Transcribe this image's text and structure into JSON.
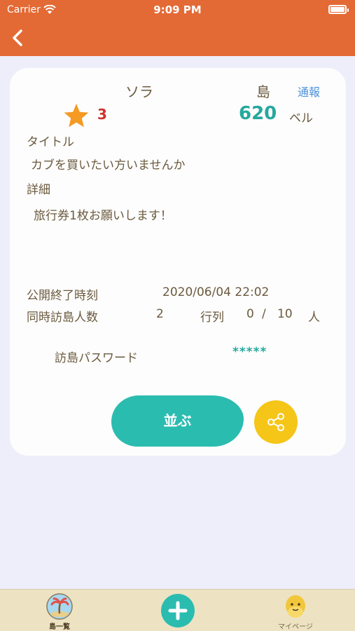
{
  "status_bar": {
    "carrier": "Carrier",
    "time": "9:09 PM"
  },
  "navbar": {
    "back_icon": "chevron-left-icon"
  },
  "card": {
    "owner_name": "ソラ",
    "island_name": "島",
    "report_label": "通報",
    "rating": "3",
    "price": "620",
    "price_unit": "ベル",
    "title_label": "タイトル",
    "title_value": "カブを買いたい方いませんか",
    "detail_label": "詳細",
    "detail_value": "旅行券1枚お願いします！",
    "end_time_label": "公開終了時刻",
    "end_time_value": "2020/06/04 22:02",
    "visitors_label": "同時訪島人数",
    "visitors_value": "2",
    "queue_label": "行列",
    "queue_current": "0",
    "queue_separator": "/",
    "queue_max": "10",
    "queue_unit": "人",
    "password_label": "訪島パスワード",
    "password_value": "*****",
    "queue_button_label": "並ぶ",
    "share_icon": "share-icon"
  },
  "tab_bar": {
    "items": [
      {
        "label": "島一覧",
        "icon": "palm-island-icon",
        "selected": true
      },
      {
        "label": "",
        "icon": "plus-icon"
      },
      {
        "label": "マイページ",
        "icon": "villager-face-icon"
      }
    ]
  },
  "colors": {
    "header": "#e36a35",
    "background": "#eeeefb",
    "accent_teal": "#2bbcb0",
    "accent_yellow": "#f5c518",
    "rating_red": "#d0312d",
    "link_blue": "#4a90d9",
    "tab_bar": "#ede3c3"
  }
}
